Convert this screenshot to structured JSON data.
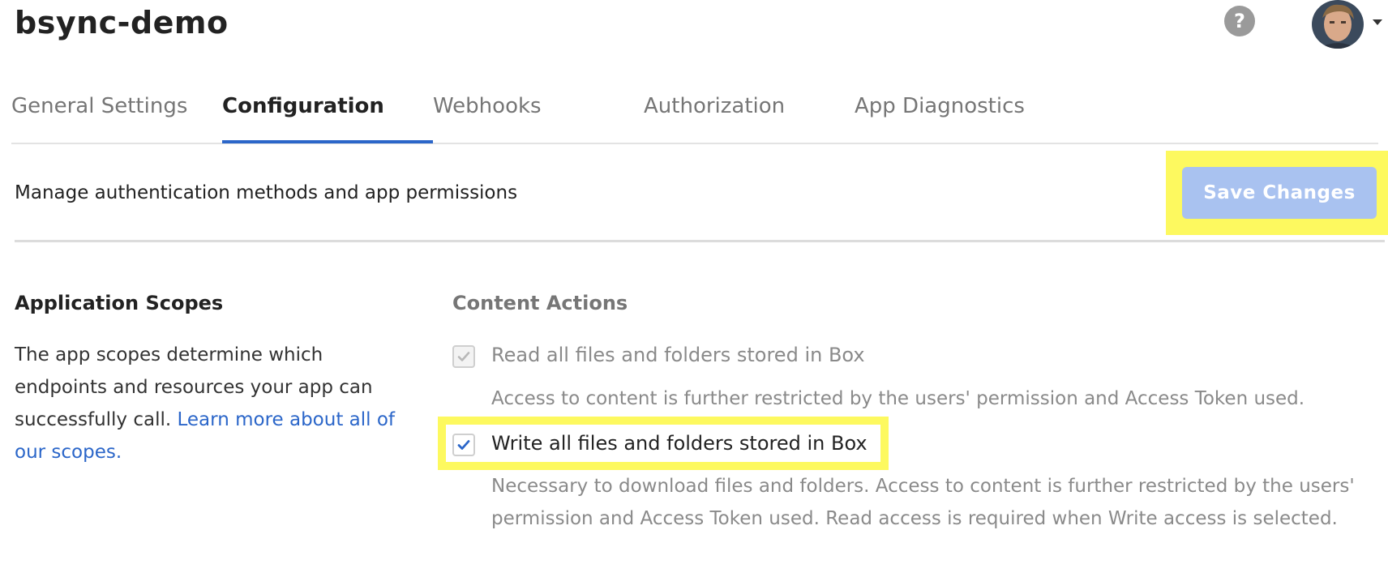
{
  "app": {
    "title": "bsync-demo",
    "help_glyph": "?"
  },
  "tabs": [
    {
      "label": "General Settings",
      "active": false
    },
    {
      "label": "Configuration",
      "active": true
    },
    {
      "label": "Webhooks",
      "active": false
    },
    {
      "label": "Authorization",
      "active": false
    },
    {
      "label": "App Diagnostics",
      "active": false
    }
  ],
  "subheader": {
    "text": "Manage authentication methods and app permissions",
    "save_label": "Save Changes"
  },
  "scopes": {
    "title": "Application Scopes",
    "description": "The app scopes determine which endpoints and resources your app can successfully call.",
    "link_text": "Learn more about all of our scopes."
  },
  "content_actions": {
    "title": "Content Actions",
    "read": {
      "label": "Read all files and folders stored in Box",
      "help": "Access to content is further restricted by the users' permission and Access Token used.",
      "checked": true,
      "disabled": true
    },
    "write": {
      "label": "Write all files and folders stored in Box",
      "help": "Necessary to download files and folders. Access to content is further restricted by the users' permission and Access Token used. Read access is required when Write access is selected.",
      "checked": true,
      "disabled": false
    }
  },
  "colors": {
    "accent": "#2b66c9",
    "highlight": "#fdf95f",
    "save_button_bg": "#a9c2f0"
  },
  "icons": {
    "help": "help-icon",
    "avatar": "user-avatar",
    "caret": "chevron-down-icon",
    "check": "check-icon"
  }
}
